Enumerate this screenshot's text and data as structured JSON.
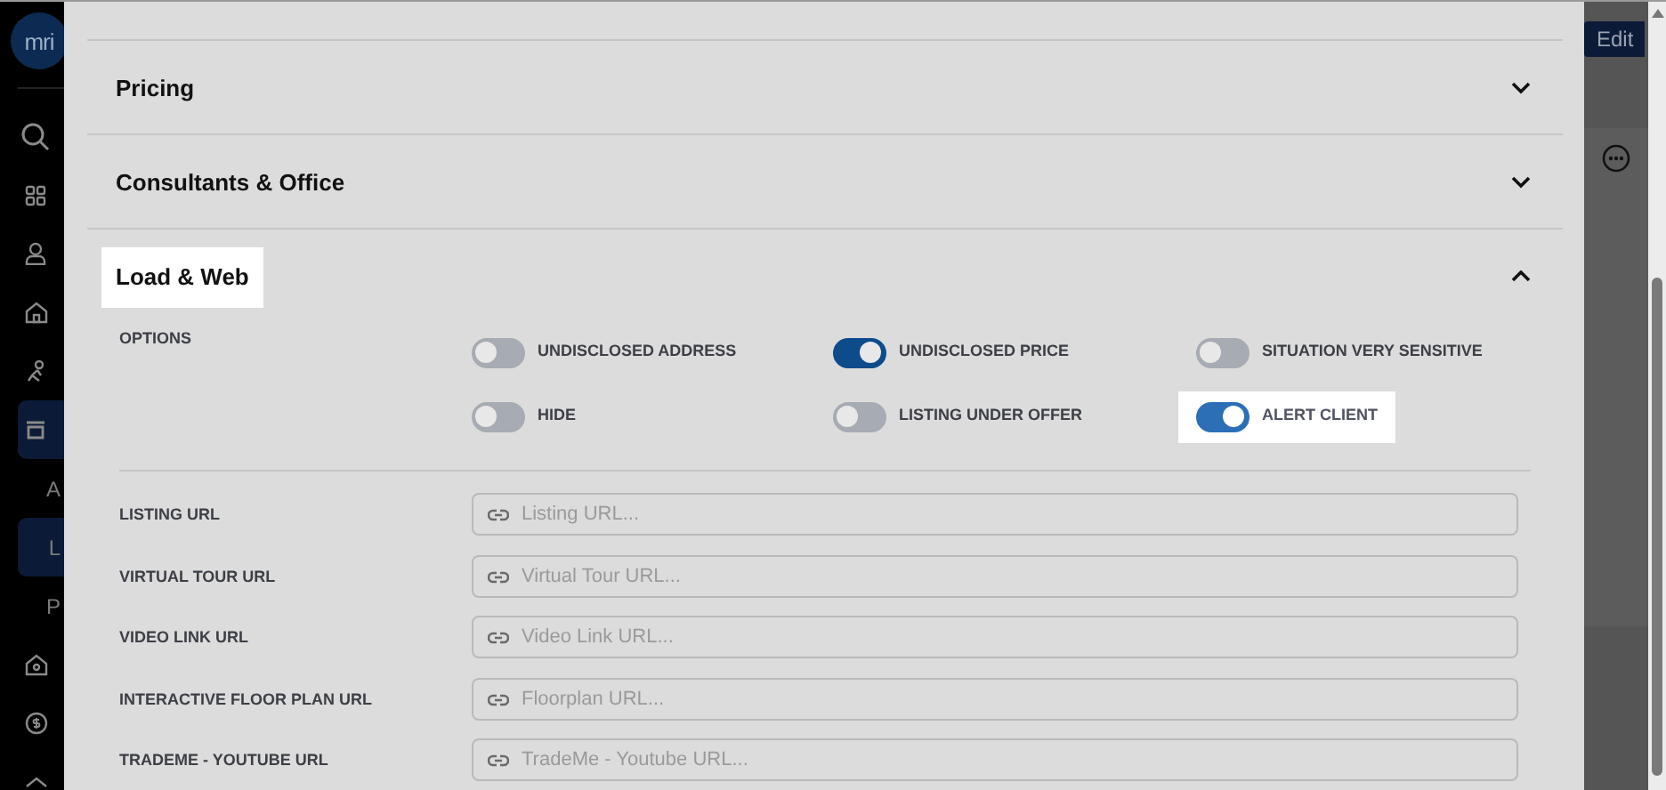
{
  "sidebar": {
    "logo": "mri",
    "items": [
      {
        "kind": "icon",
        "selected": false
      },
      {
        "kind": "icon",
        "selected": false
      },
      {
        "kind": "icon",
        "selected": false
      },
      {
        "kind": "icon",
        "selected": false
      },
      {
        "kind": "icon",
        "selected": false
      },
      {
        "kind": "icon",
        "selected": true
      },
      {
        "kind": "subitem",
        "label": "A",
        "selected": false
      },
      {
        "kind": "subitem",
        "label": "L",
        "selected": true
      },
      {
        "kind": "subitem",
        "label": "P",
        "selected": false
      },
      {
        "kind": "icon",
        "selected": false
      },
      {
        "kind": "icon",
        "selected": false
      },
      {
        "kind": "icon",
        "selected": false
      }
    ]
  },
  "edit_button": "Edit",
  "sections": [
    {
      "title": "Pricing",
      "expanded": false,
      "highlighted": false
    },
    {
      "title": "Consultants & Office",
      "expanded": false,
      "highlighted": false
    },
    {
      "title": "Load & Web",
      "expanded": true,
      "highlighted": true,
      "options_label": "OPTIONS",
      "options": [
        {
          "label": "UNDISCLOSED ADDRESS",
          "on": false,
          "highlighted": false
        },
        {
          "label": "UNDISCLOSED PRICE",
          "on": true,
          "highlighted": false
        },
        {
          "label": "SITUATION VERY SENSITIVE",
          "on": false,
          "highlighted": false
        },
        {
          "label": "HIDE",
          "on": false,
          "highlighted": false
        },
        {
          "label": "LISTING UNDER OFFER",
          "on": false,
          "highlighted": false
        },
        {
          "label": "ALERT CLIENT",
          "on": true,
          "highlighted": true
        }
      ],
      "url_fields": [
        {
          "label": "LISTING URL",
          "placeholder": "Listing URL..."
        },
        {
          "label": "VIRTUAL TOUR URL",
          "placeholder": "Virtual Tour URL..."
        },
        {
          "label": "VIDEO LINK URL",
          "placeholder": "Video Link URL..."
        },
        {
          "label": "INTERACTIVE FLOOR PLAN URL",
          "placeholder": "Floorplan URL..."
        },
        {
          "label": "TRADEME - YOUTUBE URL",
          "placeholder": "TradeMe - Youtube URL..."
        }
      ]
    }
  ]
}
